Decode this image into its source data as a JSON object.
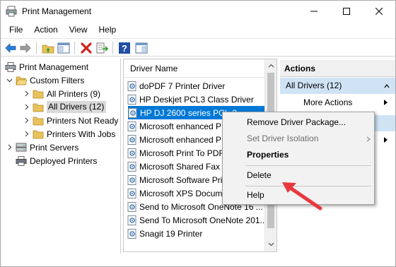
{
  "window": {
    "title": "Print Management"
  },
  "menu": [
    "File",
    "Action",
    "View",
    "Help"
  ],
  "toolbar": {
    "icons": [
      "back-arrow-icon",
      "forward-arrow-icon",
      "folder-up-icon",
      "show-hide-tree-icon",
      "delete-x-icon",
      "export-list-icon",
      "help-icon",
      "console-view-icon"
    ]
  },
  "tree": {
    "root": "Print Management",
    "custom_filters": "Custom Filters",
    "filters": [
      {
        "label": "All Printers (9)",
        "selected": false
      },
      {
        "label": "All Drivers (12)",
        "selected": true
      },
      {
        "label": "Printers Not Ready",
        "selected": false
      },
      {
        "label": "Printers With Jobs",
        "selected": false
      }
    ],
    "print_servers": "Print Servers",
    "deployed_printers": "Deployed Printers"
  },
  "list": {
    "column_header": "Driver Name",
    "rows": [
      "doPDF 7 Printer Driver",
      "HP Deskjet PCL3 Class Driver",
      "HP DJ 2600 series PCL-3",
      "Microsoft enhanced P",
      "Microsoft enhanced P",
      "Microsoft Print To PDF",
      "Microsoft Shared Fax D",
      "Microsoft Software Pri",
      "Microsoft XPS Docum",
      "Send to Microsoft OneNote 16 ...",
      "Send To Microsoft OneNote 201...",
      "Snagit 19 Printer"
    ],
    "selected_index": 2
  },
  "actions": {
    "header": "Actions",
    "section": "All Drivers (12)",
    "more_actions": "More Actions"
  },
  "context_menu": {
    "items": [
      {
        "label": "Remove Driver Package...",
        "disabled": false,
        "bold": false
      },
      {
        "label": "Set Driver Isolation",
        "disabled": true,
        "bold": false,
        "submenu": true
      },
      {
        "label": "Properties",
        "disabled": false,
        "bold": true
      },
      {
        "label": "Delete",
        "disabled": false,
        "bold": false
      },
      {
        "label": "Help",
        "disabled": false,
        "bold": false
      }
    ]
  },
  "colors": {
    "selection": "#0078d7",
    "section_highlight": "#cfe3f5",
    "annotation_arrow": "#e8383d",
    "tree_selected": "#d9d9d9"
  }
}
